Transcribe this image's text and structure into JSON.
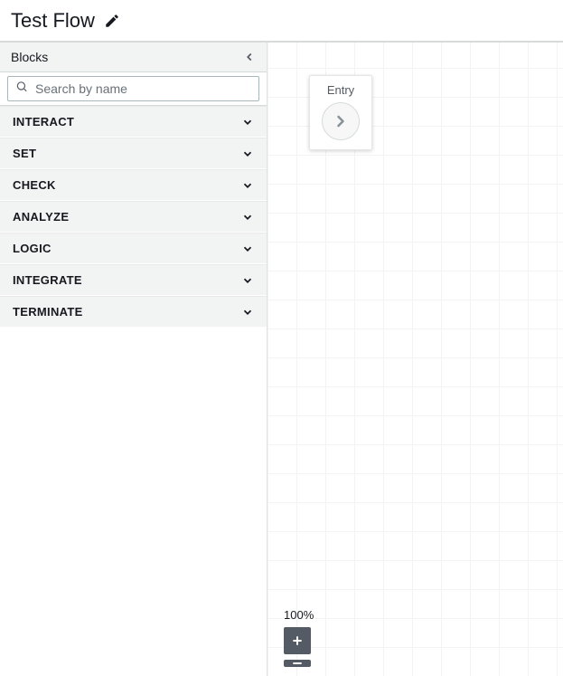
{
  "header": {
    "title": "Test Flow"
  },
  "sidebar": {
    "header_label": "Blocks",
    "search_placeholder": "Search by name",
    "categories": [
      {
        "label": "INTERACT"
      },
      {
        "label": "SET"
      },
      {
        "label": "CHECK"
      },
      {
        "label": "ANALYZE"
      },
      {
        "label": "LOGIC"
      },
      {
        "label": "INTEGRATE"
      },
      {
        "label": "TERMINATE"
      }
    ]
  },
  "canvas": {
    "entry_label": "Entry",
    "zoom_percent": "100%"
  },
  "colors": {
    "panel_bg": "#f2f3f3",
    "border": "#d5dbdb",
    "text": "#16191f",
    "muted": "#687078",
    "btn_dark": "#545b64"
  }
}
